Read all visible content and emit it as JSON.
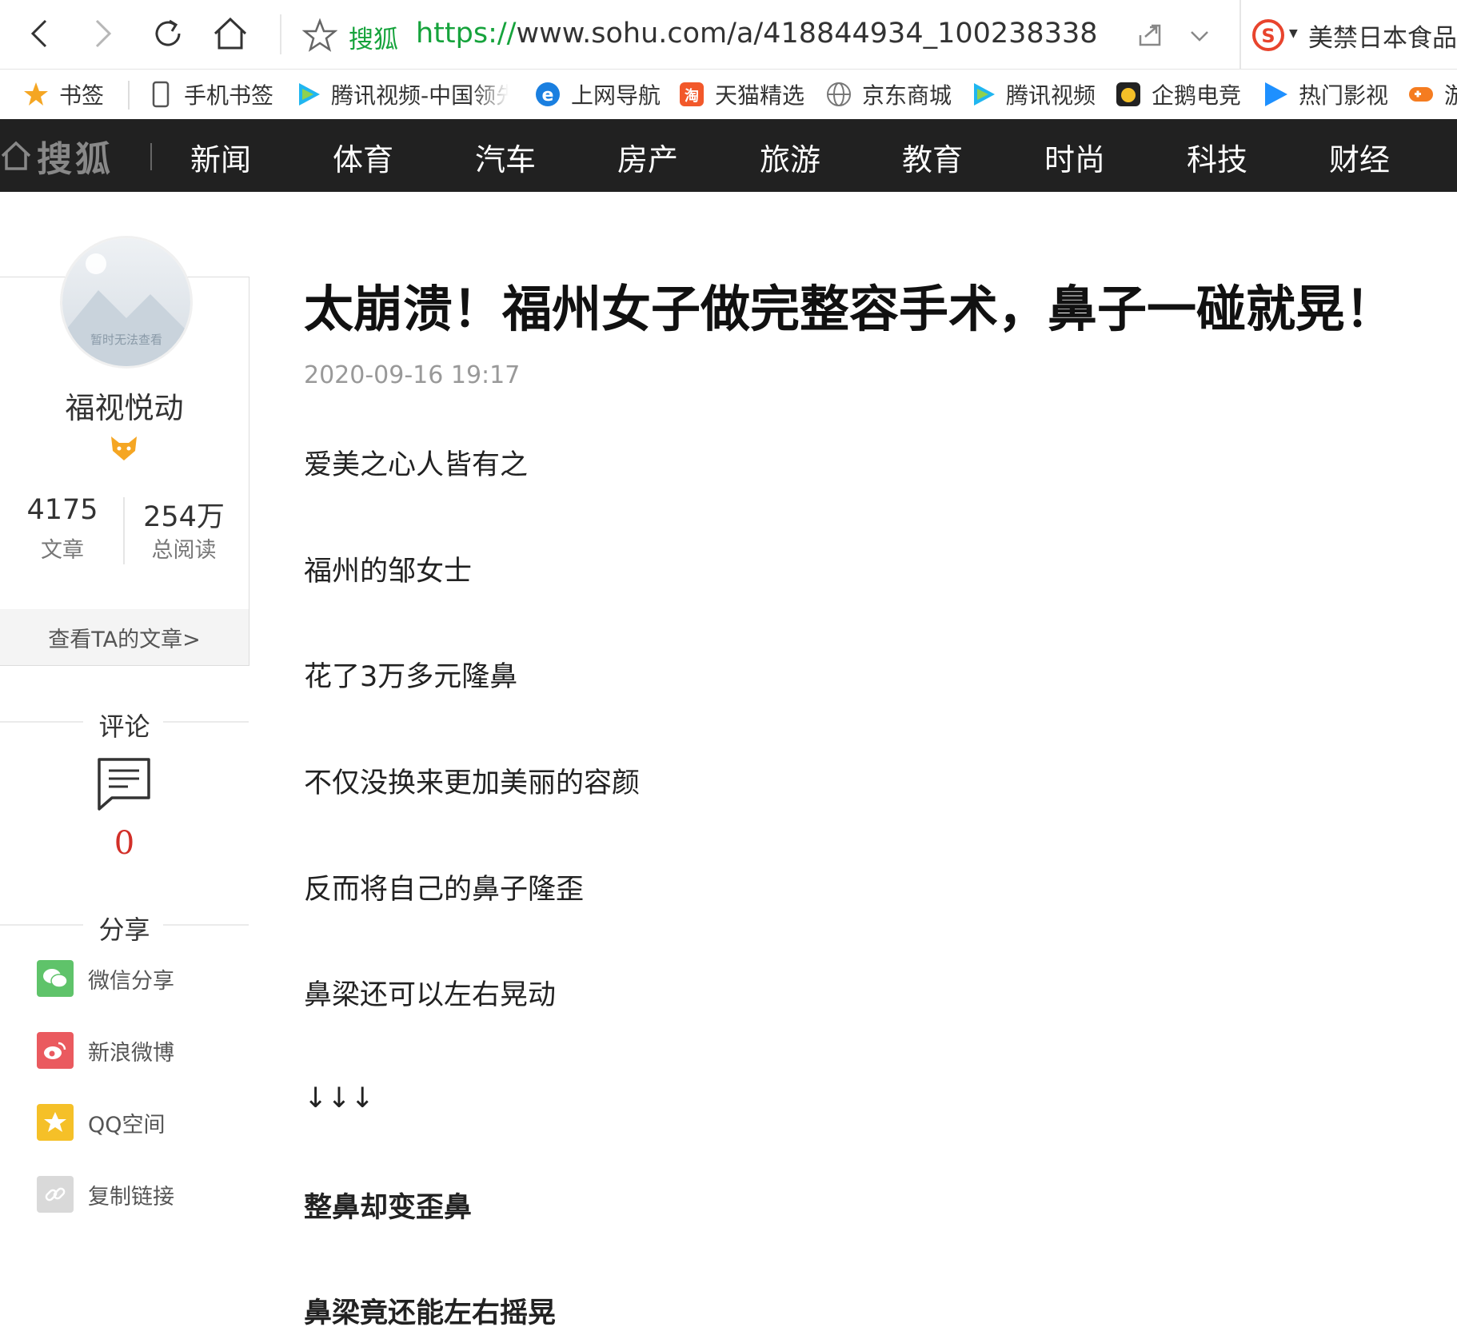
{
  "browser": {
    "site_name": "搜狐",
    "url_protocol": "https://",
    "url_rest": "www.sohu.com/a/418844934_100238338",
    "search_text": "美禁日本食品进"
  },
  "bookmarks": [
    {
      "label": "书签",
      "icon": "star-icon"
    },
    {
      "label": "手机书签",
      "icon": "phone-icon"
    },
    {
      "label": "腾讯视频-中国领先",
      "icon": "tencent-video-icon"
    },
    {
      "label": "上网导航",
      "icon": "ie-icon"
    },
    {
      "label": "天猫精选",
      "icon": "taobao-icon"
    },
    {
      "label": "京东商城",
      "icon": "globe-icon"
    },
    {
      "label": "腾讯视频",
      "icon": "tencent-video-icon"
    },
    {
      "label": "企鹅电竞",
      "icon": "penguin-esports-icon"
    },
    {
      "label": "热门影视",
      "icon": "play-icon"
    },
    {
      "label": "游",
      "icon": "game-icon"
    }
  ],
  "sohu_nav": {
    "logo": "搜狐",
    "items": [
      "新闻",
      "体育",
      "汽车",
      "房产",
      "旅游",
      "教育",
      "时尚",
      "科技",
      "财经"
    ]
  },
  "author": {
    "avatar_text": "暂时无法查看",
    "name": "福视悦动",
    "articles_count": "4175",
    "articles_label": "文章",
    "reads_count": "254万",
    "reads_label": "总阅读",
    "view_link": "查看TA的文章>"
  },
  "comments": {
    "title": "评论",
    "count": "0"
  },
  "share": {
    "title": "分享",
    "items": [
      {
        "label": "微信分享",
        "icon": "wechat-icon",
        "color": "#5fc36a"
      },
      {
        "label": "新浪微博",
        "icon": "weibo-icon",
        "color": "#ea5a5f"
      },
      {
        "label": "QQ空间",
        "icon": "qzone-icon",
        "color": "#f5c028"
      },
      {
        "label": "复制链接",
        "icon": "link-icon",
        "color": "#d9d9d9"
      }
    ]
  },
  "article": {
    "title": "太崩溃！福州女子做完整容手术，鼻子一碰就晃！",
    "date": "2020-09-16 19:17",
    "paragraphs": [
      {
        "text": "爱美之心人皆有之",
        "bold": false
      },
      {
        "text": "福州的邹女士",
        "bold": false
      },
      {
        "text": "花了3万多元隆鼻",
        "bold": false
      },
      {
        "text": "不仅没换来更加美丽的容颜",
        "bold": false
      },
      {
        "text": "反而将自己的鼻子隆歪",
        "bold": false
      },
      {
        "text": "鼻梁还可以左右晃动",
        "bold": false
      },
      {
        "text": "↓↓↓",
        "bold": false
      },
      {
        "text": "整鼻却变歪鼻",
        "bold": true
      },
      {
        "text": "鼻梁竟还能左右摇晃",
        "bold": true
      }
    ]
  },
  "colors": {
    "nav_bg": "#212121",
    "url_green": "#16a33c",
    "comment_red": "#d22f28"
  }
}
